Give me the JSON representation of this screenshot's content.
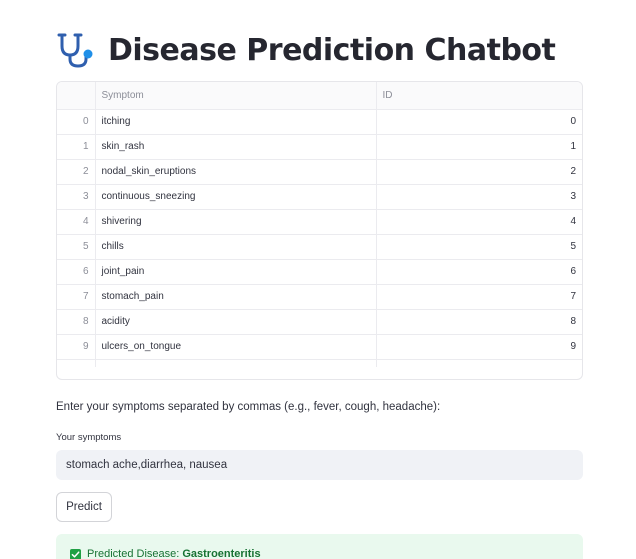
{
  "header": {
    "icon": "stethoscope-icon",
    "title": "Disease Prediction Chatbot"
  },
  "table": {
    "columns": [
      "Symptom",
      "ID"
    ],
    "rows": [
      {
        "index": "0",
        "symptom": "itching",
        "id": "0"
      },
      {
        "index": "1",
        "symptom": "skin_rash",
        "id": "1"
      },
      {
        "index": "2",
        "symptom": "nodal_skin_eruptions",
        "id": "2"
      },
      {
        "index": "3",
        "symptom": "continuous_sneezing",
        "id": "3"
      },
      {
        "index": "4",
        "symptom": "shivering",
        "id": "4"
      },
      {
        "index": "5",
        "symptom": "chills",
        "id": "5"
      },
      {
        "index": "6",
        "symptom": "joint_pain",
        "id": "6"
      },
      {
        "index": "7",
        "symptom": "stomach_pain",
        "id": "7"
      },
      {
        "index": "8",
        "symptom": "acidity",
        "id": "8"
      },
      {
        "index": "9",
        "symptom": "ulcers_on_tongue",
        "id": "9"
      }
    ]
  },
  "form": {
    "instructions": "Enter your symptoms separated by commas (e.g., fever, cough, headache):",
    "input_label": "Your symptoms",
    "input_value": "stomach ache,diarrhea, nausea",
    "button_label": "Predict"
  },
  "result": {
    "icon": "check-box-icon",
    "prefix": "Predicted Disease:",
    "disease": "Gastroenteritis"
  },
  "colors": {
    "success_bg": "#e9f9ee",
    "success_text": "#177233",
    "input_bg": "#f0f2f6",
    "title_text": "#262730"
  }
}
